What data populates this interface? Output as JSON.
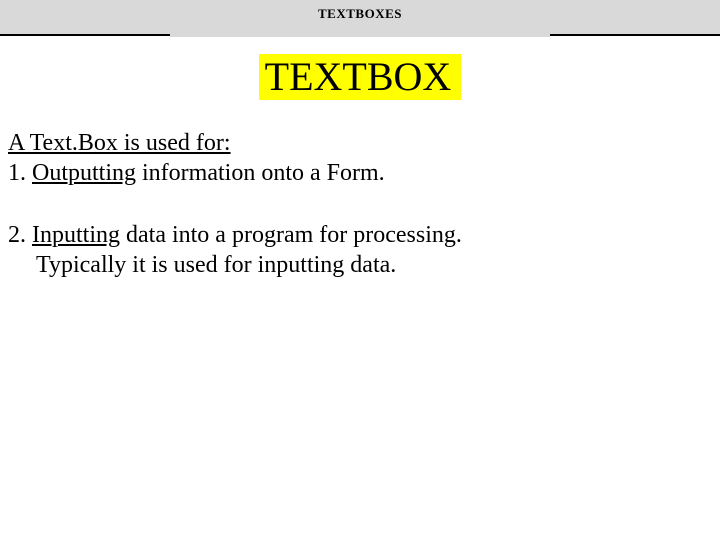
{
  "header": {
    "small_title": "TEXTBOXES"
  },
  "main": {
    "heading": "TEXTBOX",
    "intro": "A Text.Box is used for:",
    "items": [
      {
        "num": "1. ",
        "keyword": "Outputting",
        "rest": " information onto a Form."
      },
      {
        "num": "2. ",
        "keyword": "Inputting",
        "rest": " data into a program for processing.",
        "cont": "Typically it is used for inputting data."
      }
    ]
  }
}
